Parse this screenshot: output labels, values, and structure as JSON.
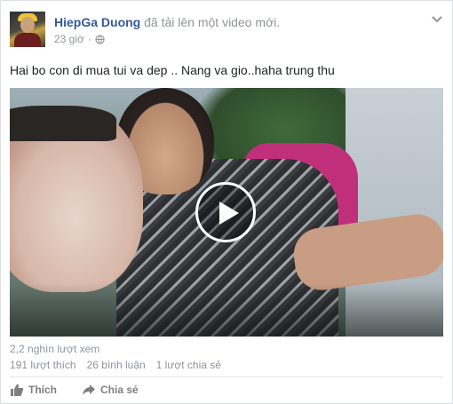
{
  "post": {
    "author_name": "HiepGa Duong",
    "author_action": "đã tải lên một video mới.",
    "timestamp": "23 giờ",
    "audience_icon": "globe-icon",
    "menu_icon": "chevron-down-icon",
    "text": "Hai bo con di mua tui va dep .. Nang va gio..haha trung thu"
  },
  "video": {
    "play_icon": "play-icon",
    "views": "2,2 nghìn lượt xem"
  },
  "stats": {
    "likes": "191 lượt thích",
    "comments": "26 bình luận",
    "shares": "1 lượt chia sẻ"
  },
  "actions": {
    "like_label": "Thích",
    "like_icon": "thumbs-up-icon",
    "share_label": "Chia sẻ",
    "share_icon": "share-arrow-icon"
  },
  "colors": {
    "link_blue": "#365899",
    "meta_gray": "#90949c",
    "action_gray": "#7f7f7f"
  }
}
